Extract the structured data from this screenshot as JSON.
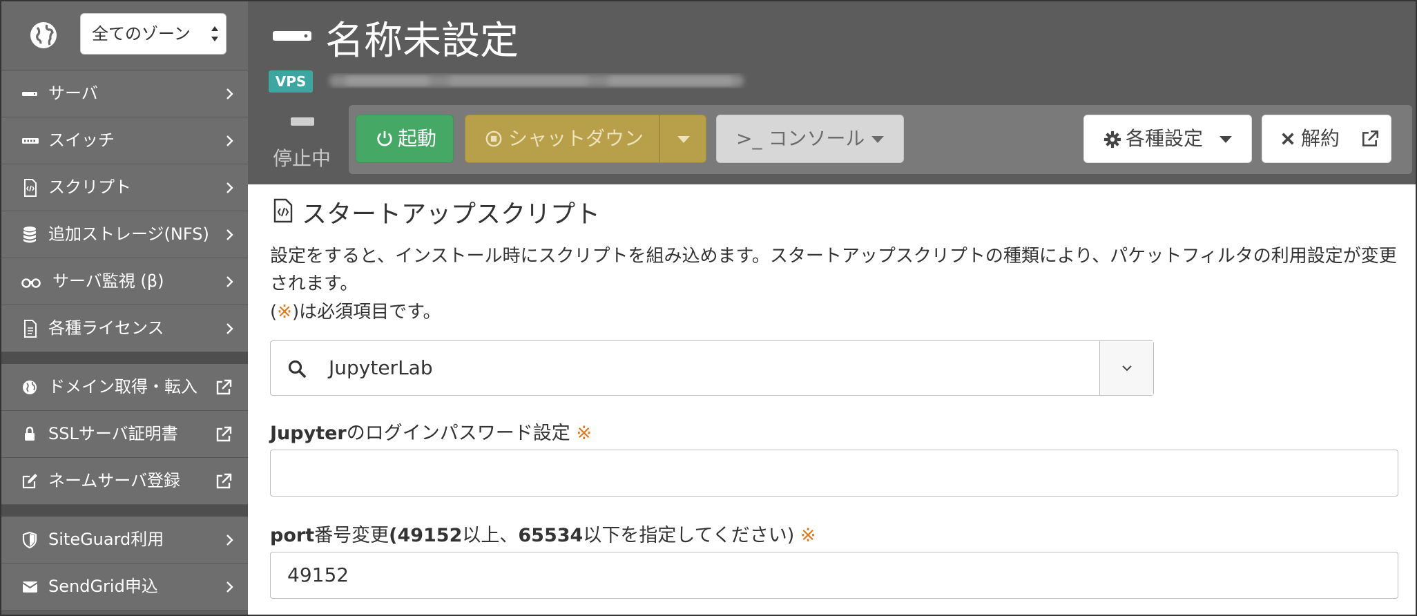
{
  "sidebar": {
    "zone_select": "全てのゾーン",
    "group1": [
      {
        "label": "サーバ",
        "icon": "server-icon"
      },
      {
        "label": "スイッチ",
        "icon": "switch-icon"
      },
      {
        "label": "スクリプト",
        "icon": "script-icon"
      },
      {
        "label": "追加ストレージ(NFS)",
        "icon": "database-icon"
      },
      {
        "label": "サーバ監視 (β)",
        "icon": "binoculars-icon"
      },
      {
        "label": "各種ライセンス",
        "icon": "document-icon"
      }
    ],
    "group2": [
      {
        "label": "ドメイン取得・転入",
        "icon": "globe-icon"
      },
      {
        "label": "SSLサーバ証明書",
        "icon": "lock-icon"
      },
      {
        "label": "ネームサーバ登録",
        "icon": "edit-icon"
      }
    ],
    "group3": [
      {
        "label": "SiteGuard利用",
        "icon": "shield-icon"
      },
      {
        "label": "SendGrid申込",
        "icon": "envelope-icon"
      }
    ]
  },
  "header": {
    "title": "名称未設定",
    "badge": "VPS",
    "status": "停止中",
    "buttons": {
      "start": "起動",
      "shutdown": "シャットダウン",
      "console": ">_ コンソール",
      "settings": "各種設定",
      "cancel": "解約"
    }
  },
  "content": {
    "section_title": "スタートアップスクリプト",
    "description": "設定をすると、インストール時にスクリプトを組み込めます。スタートアップスクリプトの種類により、パケットフィルタの利用設定が変更されます。",
    "required_note_open": "(",
    "required_mark": "※",
    "required_note_close": ")は必須項目です。",
    "script_select": "JupyterLab",
    "password_label_bold": "Jupyter",
    "password_label_rest": "のログインパスワード設定",
    "password_value": "",
    "port_label_a": "port",
    "port_label_b": "番号変更",
    "port_label_c": "(49152",
    "port_label_d": "以上、",
    "port_label_e": "65534",
    "port_label_f": "以下を指定してください)",
    "port_value": "49152"
  },
  "colors": {
    "start": "#45a865",
    "shutdown": "#b8a04a",
    "badge": "#3ba7a0",
    "required": "#e07a1f"
  }
}
